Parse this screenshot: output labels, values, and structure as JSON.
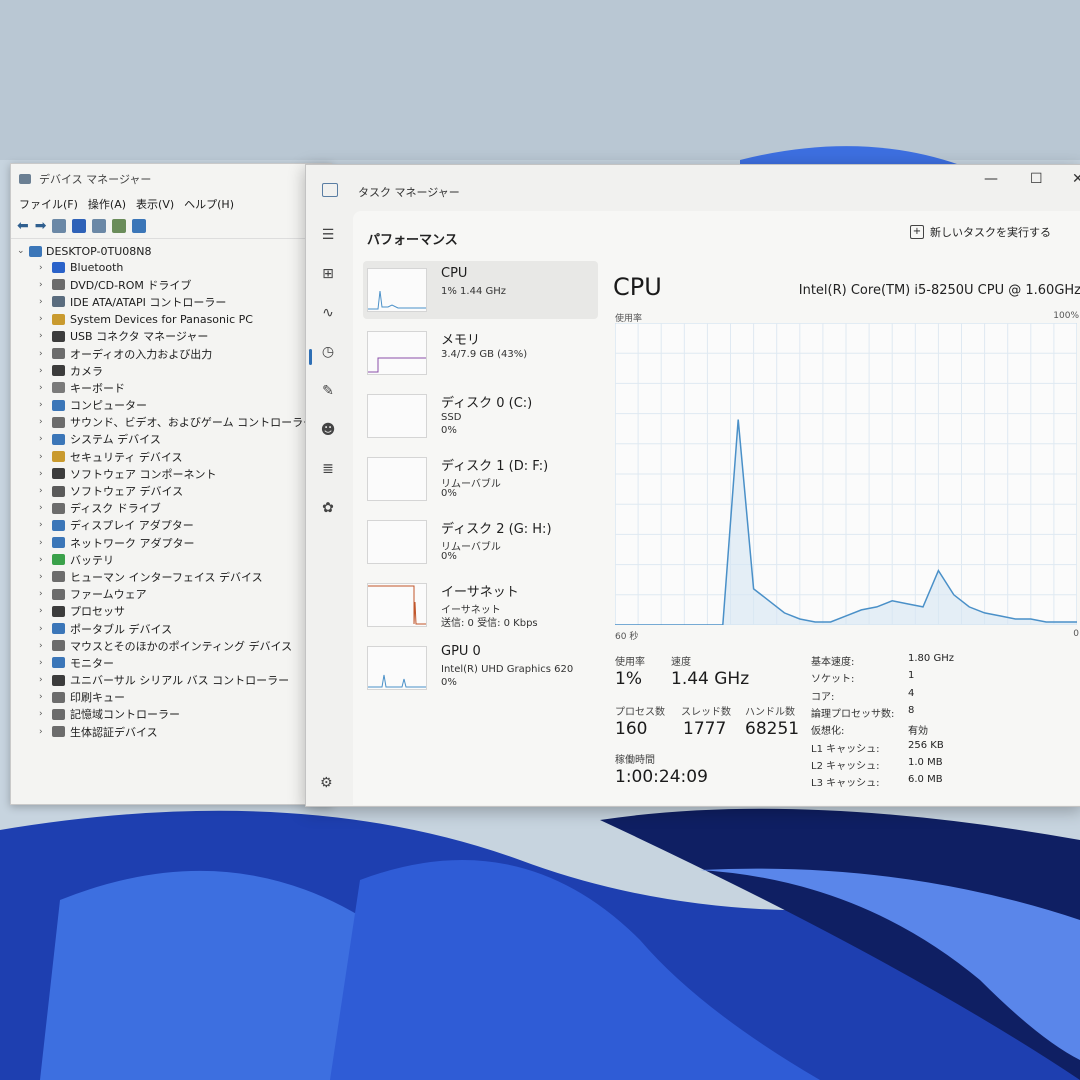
{
  "device_manager": {
    "title": "デバイス マネージャー",
    "menu": [
      "ファイル(F)",
      "操作(A)",
      "表示(V)",
      "ヘルプ(H)"
    ],
    "root": "DESKTOP-0TU08N8",
    "nodes": [
      {
        "label": "Bluetooth",
        "icon": "bluetooth-icon",
        "color": "#2a62c9"
      },
      {
        "label": "DVD/CD-ROM ドライブ",
        "icon": "disc-drive-icon",
        "color": "#6c6c6c"
      },
      {
        "label": "IDE ATA/ATAPI コントローラー",
        "icon": "controller-icon",
        "color": "#5a6c7e"
      },
      {
        "label": "System Devices for Panasonic PC",
        "icon": "folder-icon",
        "color": "#c99a2e"
      },
      {
        "label": "USB コネクタ マネージャー",
        "icon": "usb-icon",
        "color": "#3c3c3c"
      },
      {
        "label": "オーディオの入力および出力",
        "icon": "speaker-icon",
        "color": "#6c6c6c"
      },
      {
        "label": "カメラ",
        "icon": "camera-icon",
        "color": "#3c3c3c"
      },
      {
        "label": "キーボード",
        "icon": "keyboard-icon",
        "color": "#7a7a7a"
      },
      {
        "label": "コンピューター",
        "icon": "computer-icon",
        "color": "#3b76b8"
      },
      {
        "label": "サウンド、ビデオ、およびゲーム コントローラー",
        "icon": "sound-icon",
        "color": "#6c6c6c"
      },
      {
        "label": "システム デバイス",
        "icon": "system-device-icon",
        "color": "#3b76b8"
      },
      {
        "label": "セキュリティ デバイス",
        "icon": "security-icon",
        "color": "#c99a2e"
      },
      {
        "label": "ソフトウェア コンポーネント",
        "icon": "software-component-icon",
        "color": "#3c3c3c"
      },
      {
        "label": "ソフトウェア デバイス",
        "icon": "software-device-icon",
        "color": "#5a5a5a"
      },
      {
        "label": "ディスク ドライブ",
        "icon": "disk-drive-icon",
        "color": "#6c6c6c"
      },
      {
        "label": "ディスプレイ アダプター",
        "icon": "display-adapter-icon",
        "color": "#3b76b8"
      },
      {
        "label": "ネットワーク アダプター",
        "icon": "network-adapter-icon",
        "color": "#3b76b8"
      },
      {
        "label": "バッテリ",
        "icon": "battery-icon",
        "color": "#3aa14a"
      },
      {
        "label": "ヒューマン インターフェイス デバイス",
        "icon": "hid-icon",
        "color": "#6c6c6c"
      },
      {
        "label": "ファームウェア",
        "icon": "firmware-icon",
        "color": "#6c6c6c"
      },
      {
        "label": "プロセッサ",
        "icon": "processor-icon",
        "color": "#3c3c3c"
      },
      {
        "label": "ポータブル デバイス",
        "icon": "portable-device-icon",
        "color": "#3b76b8"
      },
      {
        "label": "マウスとそのほかのポインティング デバイス",
        "icon": "mouse-icon",
        "color": "#6c6c6c"
      },
      {
        "label": "モニター",
        "icon": "monitor-icon",
        "color": "#3b76b8"
      },
      {
        "label": "ユニバーサル シリアル バス コントローラー",
        "icon": "usb-controller-icon",
        "color": "#3c3c3c"
      },
      {
        "label": "印刷キュー",
        "icon": "printer-icon",
        "color": "#6c6c6c"
      },
      {
        "label": "記憶域コントローラー",
        "icon": "storage-controller-icon",
        "color": "#6c6c6c"
      },
      {
        "label": "生体認証デバイス",
        "icon": "biometric-icon",
        "color": "#6c6c6c"
      }
    ]
  },
  "task_manager": {
    "title": "タスク マネージャー",
    "page_title": "パフォーマンス",
    "run_task": "新しいタスクを実行する",
    "resources": [
      {
        "name": "CPU",
        "sub1": "1%  1.44 GHz",
        "sub2": ""
      },
      {
        "name": "メモリ",
        "sub1": "3.4/7.9 GB (43%)",
        "sub2": ""
      },
      {
        "name": "ディスク 0 (C:)",
        "sub1": "SSD",
        "sub2": "0%"
      },
      {
        "name": "ディスク 1 (D: F:)",
        "sub1": "リムーバブル",
        "sub2": "0%"
      },
      {
        "name": "ディスク 2 (G: H:)",
        "sub1": "リムーバブル",
        "sub2": "0%"
      },
      {
        "name": "イーサネット",
        "sub1": "イーサネット",
        "sub2": "送信: 0 受信: 0 Kbps"
      },
      {
        "name": "GPU 0",
        "sub1": "Intel(R) UHD Graphics 620",
        "sub2": "0%"
      }
    ],
    "detail": {
      "title": "CPU",
      "model": "Intel(R) Core(TM) i5-8250U CPU @ 1.60GHz",
      "usage_label": "使用率",
      "max_label": "100%",
      "x_left": "60 秒",
      "x_right": "0",
      "usage_label2": "使用率",
      "usage_value": "1%",
      "speed_label": "速度",
      "speed_value": "1.44 GHz",
      "process_label": "プロセス数",
      "process_value": "160",
      "thread_label": "スレッド数",
      "thread_value": "1777",
      "handle_label": "ハンドル数",
      "handle_value": "68251",
      "uptime_label": "稼働時間",
      "uptime_value": "1:00:24:09",
      "specs": [
        {
          "k": "基本速度:",
          "v": "1.80 GHz"
        },
        {
          "k": "ソケット:",
          "v": "1"
        },
        {
          "k": "コア:",
          "v": "4"
        },
        {
          "k": "論理プロセッサ数:",
          "v": "8"
        },
        {
          "k": "仮想化:",
          "v": "有効"
        },
        {
          "k": "L1 キャッシュ:",
          "v": "256 KB"
        },
        {
          "k": "L2 キャッシュ:",
          "v": "1.0 MB"
        },
        {
          "k": "L3 キャッシュ:",
          "v": "6.0 MB"
        }
      ]
    }
  },
  "chart_data": {
    "type": "line",
    "x": [
      60,
      58,
      56,
      54,
      52,
      50,
      48,
      46,
      44,
      42,
      40,
      38,
      36,
      34,
      32,
      30,
      28,
      26,
      24,
      22,
      20,
      18,
      16,
      14,
      12,
      10,
      8,
      6,
      4,
      2,
      0
    ],
    "values": [
      0,
      0,
      0,
      0,
      0,
      0,
      0,
      0,
      68,
      12,
      8,
      4,
      2,
      1,
      1,
      3,
      5,
      6,
      8,
      7,
      6,
      18,
      10,
      6,
      4,
      3,
      2,
      2,
      1,
      1,
      1
    ],
    "ylim": [
      0,
      100
    ],
    "grid": true
  },
  "colors": {
    "accent": "#2e6fb5",
    "line": "#4a90c8",
    "fill": "#d5e6f4"
  }
}
